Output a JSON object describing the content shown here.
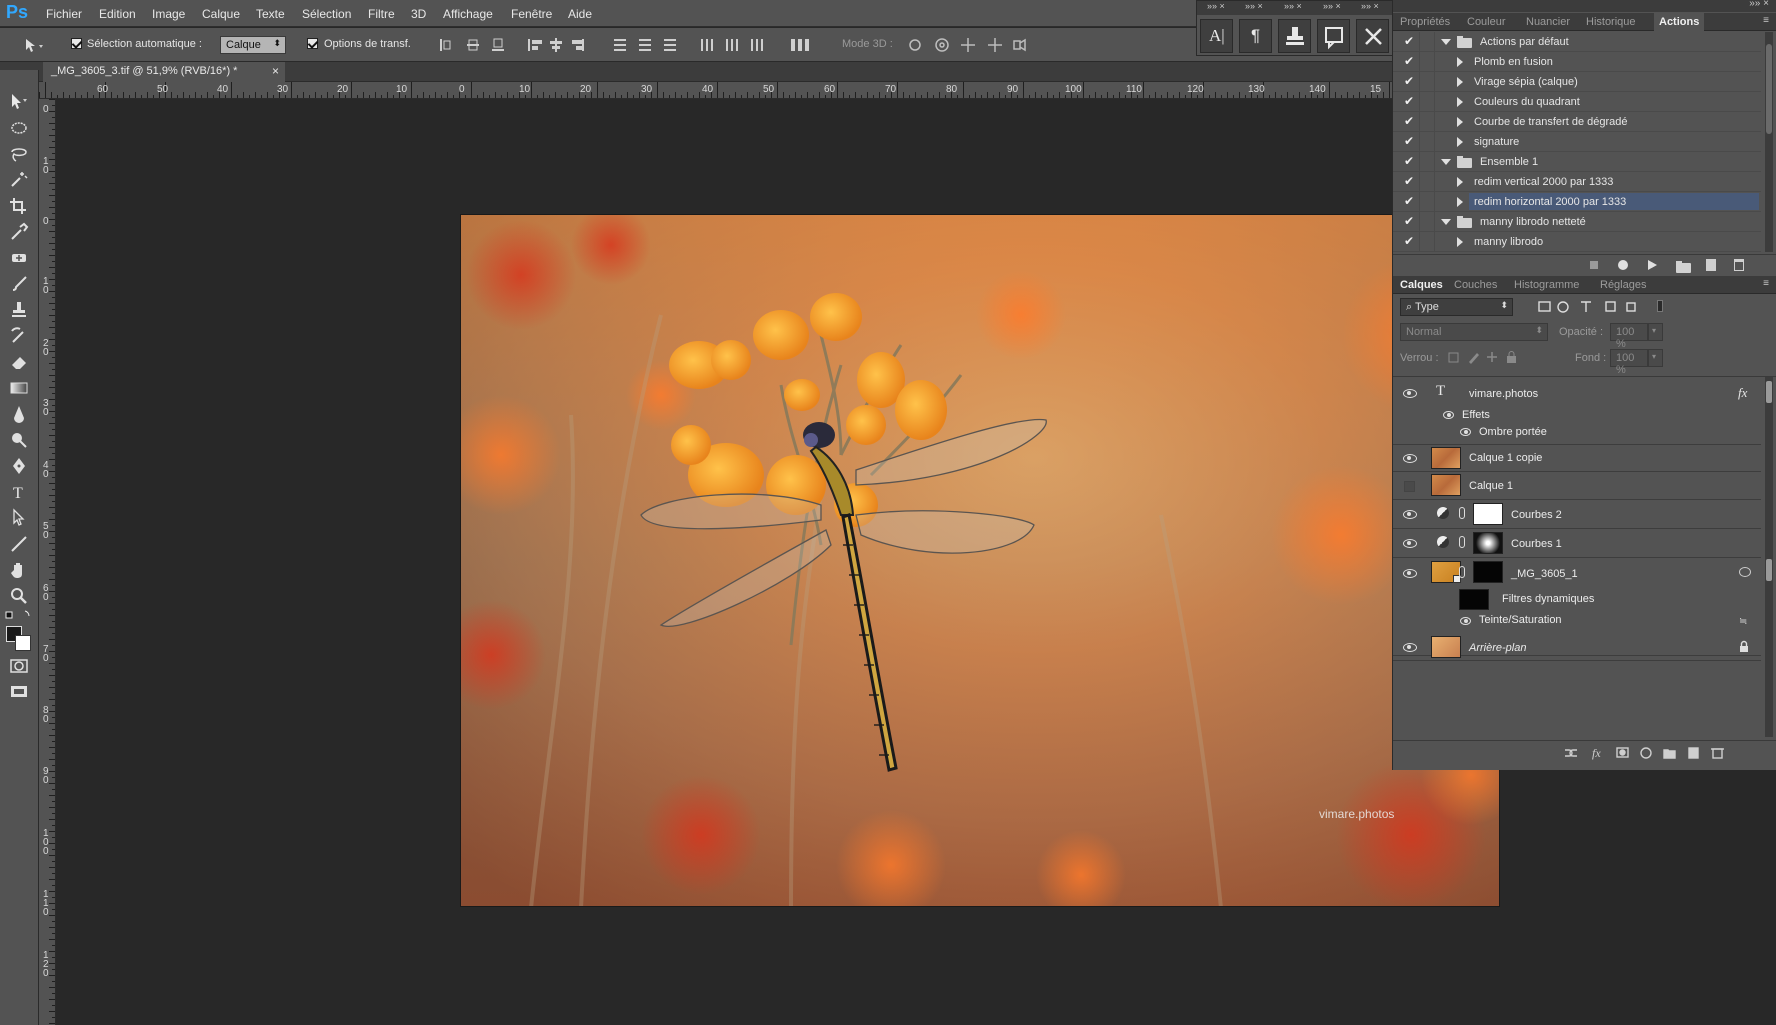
{
  "app": {
    "logo": "Ps"
  },
  "menu": [
    "Fichier",
    "Edition",
    "Image",
    "Calque",
    "Texte",
    "Sélection",
    "Filtre",
    "3D",
    "Affichage",
    "Fenêtre",
    "Aide"
  ],
  "options": {
    "auto_select_label": "Sélection automatique :",
    "auto_select_value": "Calque",
    "transform_label": "Options de transf.",
    "mode3d_label": "Mode 3D :"
  },
  "document": {
    "tab_title": "_MG_3605_3.tif @ 51,9% (RVB/16*) *",
    "close": "×"
  },
  "rulers": {
    "h": [
      "60",
      "50",
      "40",
      "30",
      "20",
      "10",
      "0",
      "10",
      "20",
      "30",
      "40",
      "50",
      "60",
      "70",
      "80",
      "90",
      "100",
      "110",
      "120",
      "130",
      "140",
      "15"
    ],
    "v": [
      {
        "a": "0",
        "b": ""
      },
      {
        "a": "1",
        "b": "0"
      },
      {
        "a": "0",
        "b": ""
      },
      {
        "a": "1",
        "b": "0"
      },
      {
        "a": "2",
        "b": "0"
      },
      {
        "a": "3",
        "b": "0"
      },
      {
        "a": "4",
        "b": "0"
      },
      {
        "a": "5",
        "b": "0"
      },
      {
        "a": "6",
        "b": "0"
      },
      {
        "a": "7",
        "b": "0"
      },
      {
        "a": "8",
        "b": "0"
      },
      {
        "a": "9",
        "b": "0"
      },
      {
        "a": "1",
        "b": "0"
      },
      {
        "a": "1",
        "b": "1"
      },
      {
        "a": "1",
        "b": "2"
      }
    ]
  },
  "watermark": "vimare.photos",
  "top_panel_tabs": [
    "Propriétés",
    "Couleur",
    "Nuancier",
    "Historique",
    "Actions"
  ],
  "actions": [
    {
      "label": "Actions par défaut",
      "type": "set",
      "expanded": true
    },
    {
      "label": "Plomb en fusion",
      "type": "action"
    },
    {
      "label": "Virage sépia (calque)",
      "type": "action"
    },
    {
      "label": "Couleurs du quadrant",
      "type": "action"
    },
    {
      "label": "Courbe de transfert de dégradé",
      "type": "action"
    },
    {
      "label": "signature",
      "type": "action"
    },
    {
      "label": "Ensemble 1",
      "type": "set",
      "expanded": true
    },
    {
      "label": "redim vertical 2000 par 1333",
      "type": "action"
    },
    {
      "label": "redim horizontal 2000 par 1333",
      "type": "action",
      "selected": true
    },
    {
      "label": "manny librodo netteté",
      "type": "set",
      "expanded": true
    },
    {
      "label": "manny librodo",
      "type": "action"
    }
  ],
  "layers_tabs": [
    "Calques",
    "Couches",
    "Histogramme",
    "Réglages"
  ],
  "layers_panel": {
    "filter": "Type",
    "blend_mode": "Normal",
    "opacity_label": "Opacité :",
    "opacity_value": "100 %",
    "lock_label": "Verrou :",
    "fill_label": "Fond :",
    "fill_value": "100 %"
  },
  "layers": {
    "text_layer": "vimare.photos",
    "effects": "Effets",
    "drop_shadow": "Ombre portée",
    "fx": "fx",
    "calque1copie": "Calque 1 copie",
    "calque1": "Calque 1",
    "courbes2": "Courbes 2",
    "courbes1": "Courbes 1",
    "smart": "_MG_3605_1",
    "filtres": "Filtres dynamiques",
    "teinte": "Teinte/Saturation",
    "background": "Arrière-plan"
  }
}
